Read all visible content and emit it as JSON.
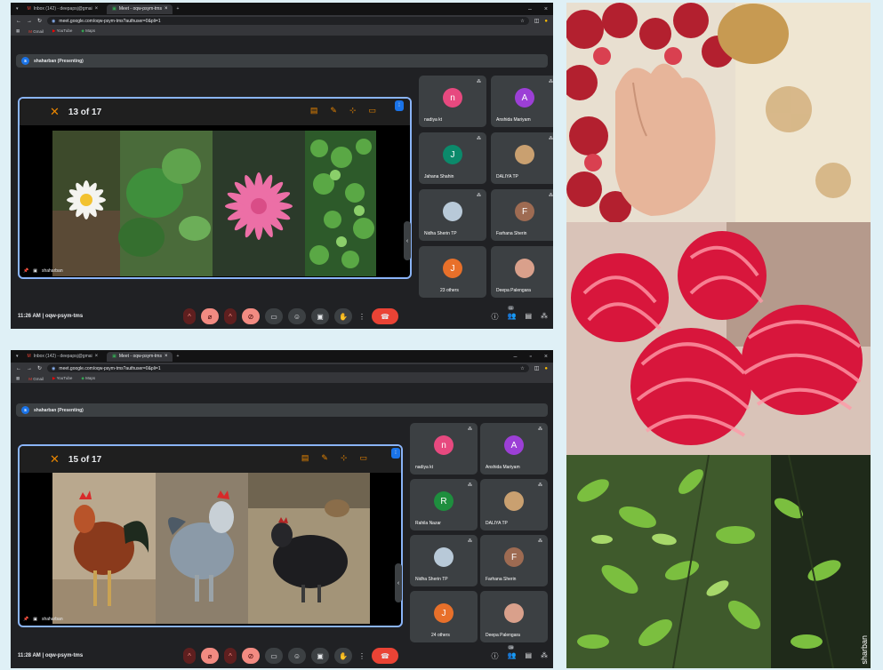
{
  "screens": [
    {
      "tabs": [
        "Inbox (142) - deepapsj@gmai",
        "Meet - oqw-psym-tms"
      ],
      "url": "meet.google.com/oqw-psym-tms?authuser=0&pli=1",
      "bookmarks": [
        "Gmail",
        "YouTube",
        "Maps"
      ],
      "presenter": "shaharban (Presenting)",
      "presenter_initial": "s",
      "slide_counter": "13 of 17",
      "stage_label": "shaharban",
      "clock": "11:26 AM",
      "meeting_code": "oqw-psym-tms",
      "participant_badge": "11",
      "participants": [
        {
          "name": "nadiya kt",
          "initial": "n",
          "color": "#e7497f"
        },
        {
          "name": "Anshida Mariyam",
          "initial": "A",
          "color": "#9c3fd6"
        },
        {
          "name": "Jahana Shahin",
          "initial": "J",
          "color": "#0b8a6b"
        },
        {
          "name": "DALIYA TP",
          "initial": "",
          "color": "#c9a070"
        },
        {
          "name": "Nidha Sherin TP",
          "initial": "",
          "color": "#b8c9d8"
        },
        {
          "name": "Farhana Sherin",
          "initial": "F",
          "color": "#9e6b52"
        },
        {
          "name": "23 others",
          "initial": "J",
          "color": "#e8702a"
        },
        {
          "name": "Deepa Palengara",
          "initial": "",
          "color": "#d9a08b"
        }
      ]
    },
    {
      "tabs": [
        "Inbox (142) - deepapsj@gmai",
        "Meet - oqw-psym-tms"
      ],
      "url": "meet.google.com/oqw-psym-tms?authuser=0&pli=1",
      "bookmarks": [
        "Gmail",
        "YouTube",
        "Maps"
      ],
      "presenter": "shaharban (Presenting)",
      "presenter_initial": "s",
      "slide_counter": "15 of 17",
      "stage_label": "shaharban",
      "clock": "11:28 AM",
      "meeting_code": "oqw-psym-tms",
      "participant_badge": "28",
      "participants": [
        {
          "name": "nadiya kt",
          "initial": "n",
          "color": "#e7497f"
        },
        {
          "name": "Anshida Mariyam",
          "initial": "A",
          "color": "#9c3fd6"
        },
        {
          "name": "Rahila Nazar",
          "initial": "R",
          "color": "#1e8e3e"
        },
        {
          "name": "DALIYA TP",
          "initial": "",
          "color": "#c9a070"
        },
        {
          "name": "Nidha Sherin TP",
          "initial": "",
          "color": "#b8c9d8"
        },
        {
          "name": "Farhana Sherin",
          "initial": "F",
          "color": "#9e6b52"
        },
        {
          "name": "24 others",
          "initial": "J",
          "color": "#e8702a"
        },
        {
          "name": "Deepa Palengara",
          "initial": "",
          "color": "#d9a08b"
        }
      ]
    }
  ],
  "side_caption": "sharban",
  "icons": [
    "mic-off-icon",
    "camera-off-icon",
    "captions-icon",
    "emoji-icon",
    "present-icon",
    "hand-icon",
    "more-icon",
    "end-call-icon",
    "info-icon",
    "people-icon",
    "chat-icon",
    "activities-icon"
  ]
}
